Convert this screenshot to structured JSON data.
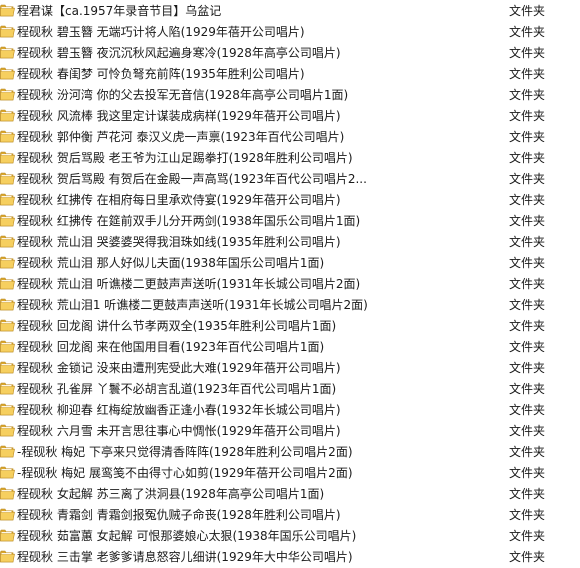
{
  "colors": {
    "folder_back": "#d9a62e",
    "folder_front": "#f6cf5f",
    "folder_edge": "#b8861b",
    "text": "#1a1a1a"
  },
  "icon": "folder-icon",
  "rows": [
    {
      "name": "程君谋【ca.1957年录音节目】乌盆记",
      "type": "文件夹"
    },
    {
      "name": "程砚秋 碧玉簪 无端巧计将人陷(1929年蓓开公司唱片)",
      "type": "文件夹"
    },
    {
      "name": "程砚秋 碧玉簪 夜沉沉秋风起遍身寒冷(1928年高亭公司唱片)",
      "type": "文件夹"
    },
    {
      "name": "程砚秋 春闺梦 可怜负弩充前阵(1935年胜利公司唱片)",
      "type": "文件夹"
    },
    {
      "name": "程砚秋 汾河湾 你的父去投军无音信(1928年高亭公司唱片1面)",
      "type": "文件夹"
    },
    {
      "name": "程砚秋 风流棒 我这里定计谋装成病样(1929年蓓开公司唱片)",
      "type": "文件夹"
    },
    {
      "name": "程砚秋 郭仲衡 芦花河 泰汉义虎一声禀(1923年百代公司唱片)",
      "type": "文件夹"
    },
    {
      "name": "程砚秋 贺后骂殿 老王爷为江山足踢拳打(1928年胜利公司唱片)",
      "type": "文件夹"
    },
    {
      "name": "程砚秋 贺后骂殿 有贺后在金殿一声高骂(1923年百代公司唱片2...",
      "type": "文件夹"
    },
    {
      "name": "程砚秋 红拂传 在相府每日里承欢侍宴(1929年蓓开公司唱片)",
      "type": "文件夹"
    },
    {
      "name": "程砚秋 红拂传 在筵前双手儿分开两剑(1938年国乐公司唱片1面)",
      "type": "文件夹"
    },
    {
      "name": "程砚秋 荒山泪 哭婆婆哭得我泪珠如线(1935年胜利公司唱片)",
      "type": "文件夹"
    },
    {
      "name": "程砚秋 荒山泪 那人好似儿夫面(1938年国乐公司唱片1面)",
      "type": "文件夹"
    },
    {
      "name": "程砚秋 荒山泪 听谯楼二更鼓声声送听(1931年长城公司唱片2面)",
      "type": "文件夹"
    },
    {
      "name": "程砚秋 荒山泪1 听谯楼二更鼓声声送听(1931年长城公司唱片2面)",
      "type": "文件夹"
    },
    {
      "name": "程砚秋 回龙阁 讲什么节孝两双全(1935年胜利公司唱片1面)",
      "type": "文件夹"
    },
    {
      "name": "程砚秋 回龙阁 来在他国用目看(1923年百代公司唱片1面)",
      "type": "文件夹"
    },
    {
      "name": "程砚秋 金锁记 没来由遭刑宪受此大难(1929年蓓开公司唱片)",
      "type": "文件夹"
    },
    {
      "name": "程砚秋 孔雀屏 丫鬟不必胡言乱道(1923年百代公司唱片1面)",
      "type": "文件夹"
    },
    {
      "name": "程砚秋 柳迎春 红梅绽放幽香正逢小春(1932年长城公司唱片)",
      "type": "文件夹"
    },
    {
      "name": "程砚秋 六月雪 未开言思往事心中惆怅(1929年蓓开公司唱片)",
      "type": "文件夹"
    },
    {
      "name": "-程砚秋 梅妃 下亭来只觉得清香阵阵(1928年胜利公司唱片2面)",
      "type": "文件夹"
    },
    {
      "name": "-程砚秋 梅妃 展鸾笺不由得寸心如剪(1929年蓓开公司唱片2面)",
      "type": "文件夹"
    },
    {
      "name": "程砚秋 女起解 苏三离了洪洞县(1928年高亭公司唱片1面)",
      "type": "文件夹"
    },
    {
      "name": "程砚秋 青霜剑 青霜剑报冤仇贼子命丧(1928年胜利公司唱片)",
      "type": "文件夹"
    },
    {
      "name": "程砚秋 茹富蕙 女起解 可恨那婆娘心太狠(1938年国乐公司唱片)",
      "type": "文件夹"
    },
    {
      "name": "程砚秋 三击掌 老爹爹请息怒容儿细讲(1929年大中华公司唱片)",
      "type": "文件夹"
    }
  ]
}
